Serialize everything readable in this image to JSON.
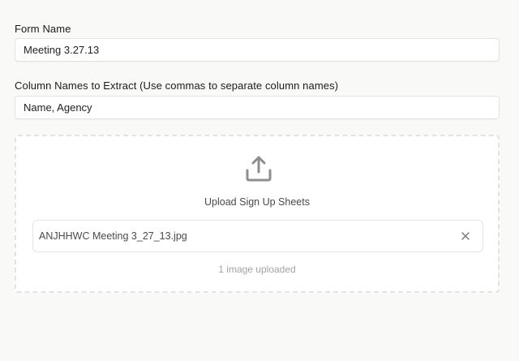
{
  "form_name": {
    "label": "Form Name",
    "value": "Meeting 3.27.13"
  },
  "column_names": {
    "label": "Column Names to Extract (Use commas to separate column names)",
    "value": "Name, Agency"
  },
  "upload": {
    "icon": "upload-icon",
    "caption": "Upload Sign Up Sheets",
    "files": [
      {
        "name": "ANJHHWC Meeting 3_27_13.jpg",
        "remove_icon": "close-icon"
      }
    ],
    "status": "1 image uploaded"
  },
  "colors": {
    "background": "#f9f9f7",
    "icon_gray": "#8e8e8e",
    "muted_text": "#a3a3a3"
  }
}
